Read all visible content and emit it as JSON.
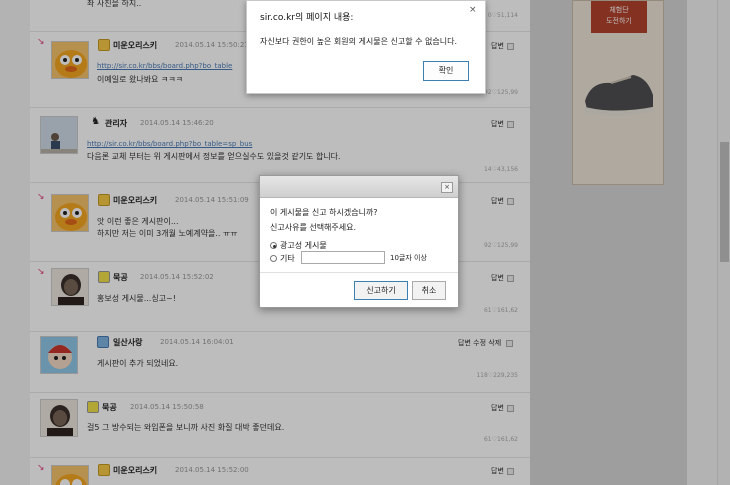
{
  "alert": {
    "title": "sir.co.kr의 페이지 내용:",
    "message": "자신보다 권한이 높은 회원의 게시물은 신고할 수 없습니다.",
    "ok_label": "확인",
    "close_glyph": "×"
  },
  "report_dialog": {
    "close_glyph": "×",
    "question": "이 게시물을 신고 하시겠습니까?",
    "instruction": "신고사유를 선택해주세요.",
    "option_ad": "광고성 게시물",
    "option_etc": "기타",
    "etc_placeholder": "",
    "etc_hint": "10글자 이상",
    "submit_label": "신고하기",
    "cancel_label": "취소"
  },
  "sidebar": {
    "ad_text_line1": "체험단",
    "ad_text_line2": "도전하기"
  },
  "comments": [
    {
      "text": "좌 사진을 하지..",
      "stats": "0♡51,114"
    },
    {
      "author": "미운오리스키",
      "date": "2014.05.14 15:50:21",
      "link": "http://sir.co.kr/bbs/board.php?bo_table",
      "text": "이예일로 왔나봐요 ㅋㅋㅋ",
      "reply_label": "답변",
      "stats": "92♡125,99"
    },
    {
      "author": "관리자",
      "date": "2014.05.14 15:46:20",
      "link": "http://sir.co.kr/bbs/board.php?bo_table=sp_bus",
      "text": "다음론 교체 부터는 위 게시판에서 정보를 얻으실수도 있을것 같기도 합니다.",
      "reply_label": "답변",
      "stats": "14♡43,156"
    },
    {
      "author": "미운오리스키",
      "date": "2014.05.14 15:51:09",
      "text_line1": "앗 이런 좋은 게시판이...",
      "text_line2": "하지만 저는 이미 3개월 노예계약을.. ㅠㅠ",
      "reply_label": "답변",
      "stats": "92♡125,99"
    },
    {
      "author": "묵공",
      "date": "2014.05.14 15:52:02",
      "text": "홍보성 게시물...싱고~!",
      "reply_label": "답변",
      "stats": "61♡161,62"
    },
    {
      "author": "일산사랑",
      "date": "2014.05.14 16:04:01",
      "text": "게시판이 추가 되었네요.",
      "reply_label": "답변",
      "edit_label": "수정",
      "delete_label": "삭제",
      "stats": "118♡229,235"
    },
    {
      "author": "묵공",
      "date": "2014.05.14 15:50:58",
      "text": "걸5 그 방수되는 와입폰을 보니까 사진 화질 대박 좋던데요.",
      "reply_label": "답변",
      "stats": "61♡161,62"
    },
    {
      "author": "미운오리스키",
      "date": "2014.05.14 15:52:00",
      "reply_label": "답변"
    }
  ],
  "colors": {
    "link": "#4a7ab5",
    "reply_mark": "#e03a7a",
    "dialog_border_accent": "#3c7fb1",
    "sidebar": "#d6d6d6"
  }
}
